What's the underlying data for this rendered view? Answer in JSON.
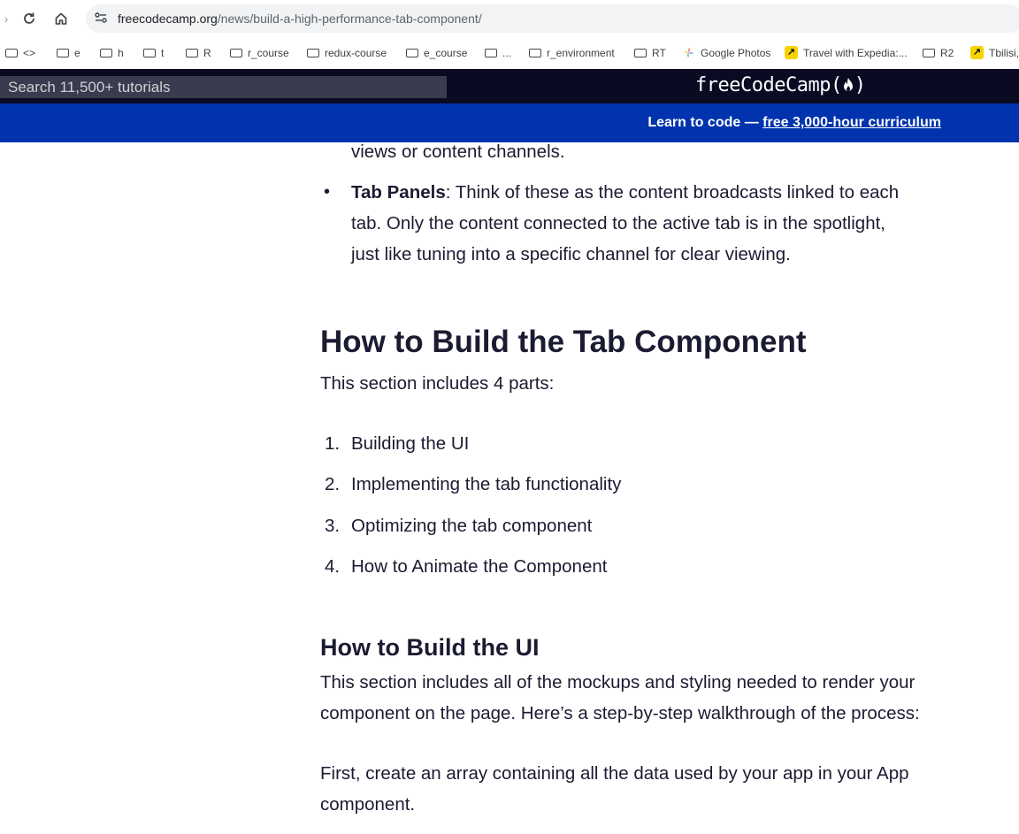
{
  "browser": {
    "url_host": "freecodecamp.org",
    "url_path": "/news/build-a-high-performance-tab-component/"
  },
  "bookmarks": [
    {
      "label": "<>",
      "icon": "folder-icon"
    },
    {
      "label": "e",
      "icon": "folder-icon"
    },
    {
      "label": "h",
      "icon": "folder-icon"
    },
    {
      "label": "t",
      "icon": "folder-icon"
    },
    {
      "label": "R",
      "icon": "folder-icon"
    },
    {
      "label": "r_course",
      "icon": "folder-icon"
    },
    {
      "label": "redux-course",
      "icon": "folder-icon"
    },
    {
      "label": "e_course",
      "icon": "folder-icon"
    },
    {
      "label": "...",
      "icon": "folder-icon"
    },
    {
      "label": "r_environment",
      "icon": "folder-icon"
    },
    {
      "label": "RT",
      "icon": "folder-icon"
    },
    {
      "label": "Google Photos",
      "icon": "google-photos-icon"
    },
    {
      "label": "Travel with Expedia:...",
      "icon": "expedia-icon"
    },
    {
      "label": "R2",
      "icon": "folder-icon"
    },
    {
      "label": "Tbilisi,",
      "icon": "expedia-icon"
    }
  ],
  "fcc": {
    "search_placeholder": "Search 11,500+ tutorials",
    "logo": "freeCodeCamp()",
    "banner_prefix": "Learn to code — ",
    "banner_link": "free 3,000-hour curriculum"
  },
  "article": {
    "li_cont": "views or content channels.",
    "tab_panels_term": "Tab Panels",
    "tab_panels_line1": ": Think of these as the content broadcasts linked to each",
    "tab_panels_line2": "tab. Only the content connected to the active tab is in the spotlight,",
    "tab_panels_line3": "just like tuning into a specific channel for clear viewing.",
    "h2": "How to Build the Tab Component",
    "intro": "This section includes 4 parts:",
    "parts": [
      {
        "num": "1.",
        "text": "Building the UI"
      },
      {
        "num": "2.",
        "text": "Implementing the tab functionality"
      },
      {
        "num": "3.",
        "text": "Optimizing the tab component"
      },
      {
        "num": "4.",
        "text": "How to Animate the Component"
      }
    ],
    "h3": "How to Build the UI",
    "p1_line1": "This section includes all of the mockups and styling needed to render your",
    "p1_line2": "component on the page. Here’s a step-by-step walkthrough of the process:",
    "p2_line1": "First, create an array containing all the data used by your app in your App",
    "p2_line2": "component."
  }
}
